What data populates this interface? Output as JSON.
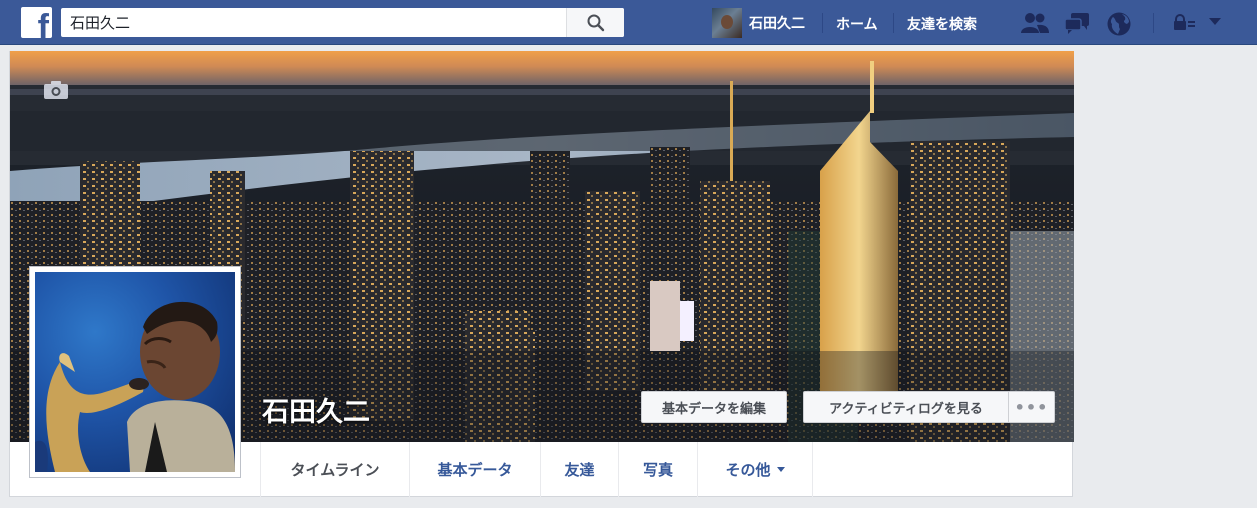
{
  "topbar": {
    "search_value": "石田久二",
    "user_name": "石田久二",
    "home_label": "ホーム",
    "find_friends_label": "友達を検索"
  },
  "profile": {
    "name": "石田久二"
  },
  "cover_buttons": {
    "edit_profile": "基本データを編集",
    "activity_log": "アクティビティログを見る",
    "more": "•••"
  },
  "tabs": [
    {
      "label": "タイムライン"
    },
    {
      "label": "基本データ"
    },
    {
      "label": "友達"
    },
    {
      "label": "写真"
    },
    {
      "label": "その他"
    }
  ],
  "colors": {
    "brand": "#3b5998",
    "link": "#365899"
  },
  "icons": [
    "facebook-logo-icon",
    "search-icon",
    "friend-requests-icon",
    "messages-icon",
    "notifications-globe-icon",
    "privacy-lock-icon",
    "account-menu-caret-icon",
    "camera-icon"
  ]
}
